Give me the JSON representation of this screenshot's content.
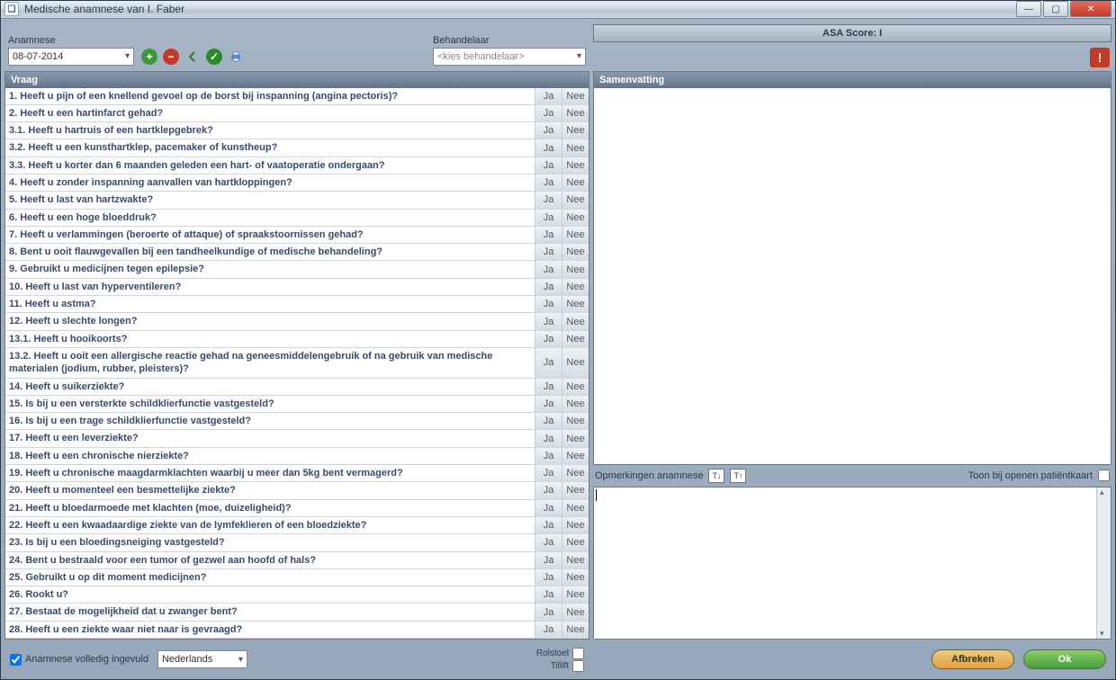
{
  "window": {
    "title": "Medische anamnese van I. Faber"
  },
  "left": {
    "anamnese_label": "Anamnese",
    "date_value": "08-07-2014",
    "behandelaar_label": "Behandelaar",
    "behandelaar_value": "<kies behandelaar>",
    "vraag_header": "Vraag",
    "ja": "Ja",
    "nee": "Nee",
    "questions": [
      "1. Heeft u pijn of een knellend gevoel op de borst bij inspanning (angina pectoris)?",
      "2. Heeft u een hartinfarct gehad?",
      "3.1. Heeft u hartruis of een hartklepgebrek?",
      "3.2. Heeft u een kunsthartklep, pacemaker of kunstheup?",
      "3.3. Heeft u korter dan 6 maanden geleden een hart- of vaatoperatie ondergaan?",
      "4. Heeft u zonder inspanning aanvallen van hartkloppingen?",
      "5. Heeft u last van hartzwakte?",
      "6. Heeft u een hoge bloeddruk?",
      "7. Heeft u verlammingen (beroerte of attaque) of spraakstoornissen gehad?",
      "8. Bent u ooit flauwgevallen bij een tandheelkundige of medische behandeling?",
      "9. Gebruikt u medicijnen tegen epilepsie?",
      "10. Heeft u last van hyperventileren?",
      "11. Heeft u astma?",
      "12. Heeft u slechte longen?",
      "13.1. Heeft u hooikoorts?",
      "13.2. Heeft u ooit een allergische reactie gehad na geneesmiddelengebruik of na gebruik van medische materialen (jodium, rubber, pleisters)?",
      "14. Heeft u suikerziekte?",
      "15. Is bij u een versterkte schildklierfunctie vastgesteld?",
      "16. Is bij u een trage schildklierfunctie vastgesteld?",
      "17. Heeft u een leverziekte?",
      "18. Heeft u een chronische nierziekte?",
      "19. Heeft u chronische maagdarmklachten waarbij u meer dan 5kg bent vermagerd?",
      "20. Heeft u momenteel een besmettelijke ziekte?",
      "21. Heeft u bloedarmoede met klachten (moe, duizeligheid)?",
      "22. Heeft u een kwaadaardige ziekte van de lymfeklieren of een bloedziekte?",
      "23. Is bij u een bloedingsneiging vastgesteld?",
      "24. Bent u bestraald voor een tumor of gezwel aan hoofd of hals?",
      "25. Gebruikt u op dit moment medicijnen?",
      "26. Rookt u?",
      "27. Bestaat de mogelijkheid dat u zwanger bent?",
      "28. Heeft u een ziekte waar niet naar is gevraagd?"
    ],
    "chk_volledig": "Anamnese volledig ingevuld",
    "lang_value": "Nederlands",
    "rolstoel": "Rolstoel",
    "tillift": "Tillift"
  },
  "right": {
    "asa": "ASA Score: I",
    "summary_header": "Samenvatting",
    "remarks_label": "Opmerkingen anamnese",
    "show_on_open": "Toon bij openen patiëntkaart",
    "cancel": "Afbreken",
    "ok": "Ok"
  }
}
